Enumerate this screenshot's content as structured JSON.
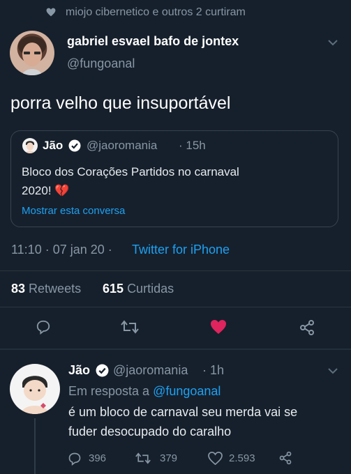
{
  "social_context": {
    "text": "miojo cibernetico e outros 2 curtiram"
  },
  "tweet": {
    "author_name": "gabriel esvael bafo de jontex",
    "author_handle": "@fungoanal",
    "text": "porra velho que insuportável",
    "quote": {
      "author_name": "Jão",
      "author_handle": "@jaoromania",
      "time": "· 15h",
      "text_line1": "Bloco dos Corações Partidos no carnaval",
      "text_line2": "2020! 💔",
      "show_thread": "Mostrar esta conversa"
    },
    "timestamp": "11:10 · 07 jan 20 ·",
    "source": "Twitter for iPhone",
    "retweets_count": "83",
    "retweets_label": "Retweets",
    "likes_count": "615",
    "likes_label": "Curtidas"
  },
  "reply": {
    "author_name": "Jão",
    "author_handle": "@jaoromania",
    "time": "· 1h",
    "in_reply_prefix": "Em resposta a",
    "in_reply_handle": "@fungoanal",
    "text_line1": "é um bloco de carnaval seu merda vai se",
    "text_line2": "fuder desocupado do caralho",
    "replies": "396",
    "retweets": "379",
    "likes": "2.593"
  },
  "colors": {
    "background": "#16202c",
    "accent": "#1da1f2",
    "like": "#e0245e",
    "muted": "#8897a5"
  }
}
